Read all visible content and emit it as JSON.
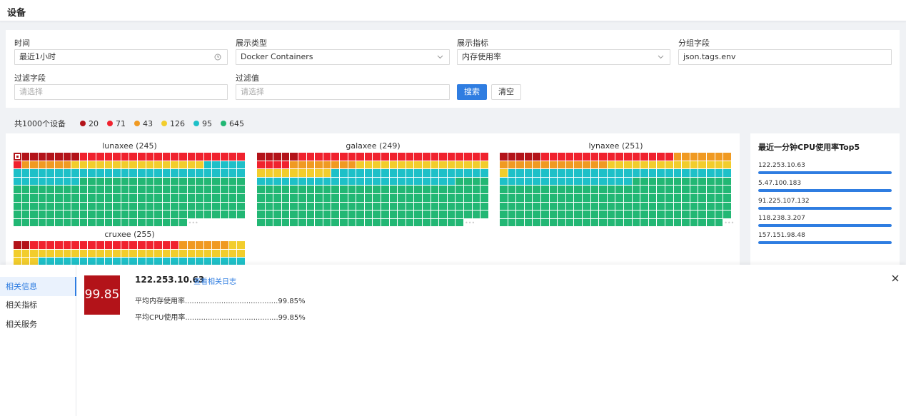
{
  "page": {
    "title": "设备"
  },
  "filters": {
    "time": {
      "label": "时间",
      "value": "最近1小时"
    },
    "display_type": {
      "label": "展示类型",
      "value": "Docker Containers"
    },
    "display_metric": {
      "label": "展示指标",
      "value": "内存使用率"
    },
    "group_field": {
      "label": "分组字段",
      "value": "json.tags.env"
    },
    "filter_field": {
      "label": "过滤字段",
      "placeholder": "请选择"
    },
    "filter_value": {
      "label": "过滤值",
      "placeholder": "请选择"
    },
    "search_label": "搜索",
    "clear_label": "清空"
  },
  "summary": {
    "total_text": "共1000个设备",
    "legend": [
      {
        "count": "20",
        "color": "#b31319"
      },
      {
        "count": "71",
        "color": "#f0222e"
      },
      {
        "count": "43",
        "color": "#f09a22"
      },
      {
        "count": "126",
        "color": "#f2cd2c"
      },
      {
        "count": "95",
        "color": "#1ec0c8"
      },
      {
        "count": "645",
        "color": "#22b774"
      }
    ]
  },
  "groups": [
    {
      "title": "lunaxee (245)",
      "counts": [
        8,
        21,
        6,
        16,
        41,
        153
      ]
    },
    {
      "title": "galaxee (249)",
      "counts": [
        5,
        27,
        8,
        25,
        43,
        141
      ]
    },
    {
      "title": "lynaxee (251)",
      "counts": [
        5,
        16,
        20,
        16,
        43,
        151
      ]
    },
    {
      "title": "cruxee (255)",
      "counts": [
        2,
        18,
        6,
        33,
        30,
        166
      ]
    }
  ],
  "top5": {
    "title": "最近一分钟CPU使用率Top5",
    "items": [
      {
        "ip": "122.253.10.63",
        "value": 1.0
      },
      {
        "ip": "5.47.100.183",
        "value": 1.0
      },
      {
        "ip": "91.225.107.132",
        "value": 1.0
      },
      {
        "ip": "118.238.3.207",
        "value": 1.0
      },
      {
        "ip": "157.151.98.48",
        "value": 1.0
      }
    ]
  },
  "detail": {
    "tabs": [
      "相关信息",
      "相关指标",
      "相关服务"
    ],
    "active_tab": 0,
    "badge_value": "99.85",
    "ip": "122.253.10.63",
    "log_link": "查看相关日志",
    "lines": [
      "平均内存使用率.........................................99.85%",
      "平均CPU使用率.........................................99.85%"
    ],
    "close_icon": "close-icon"
  }
}
